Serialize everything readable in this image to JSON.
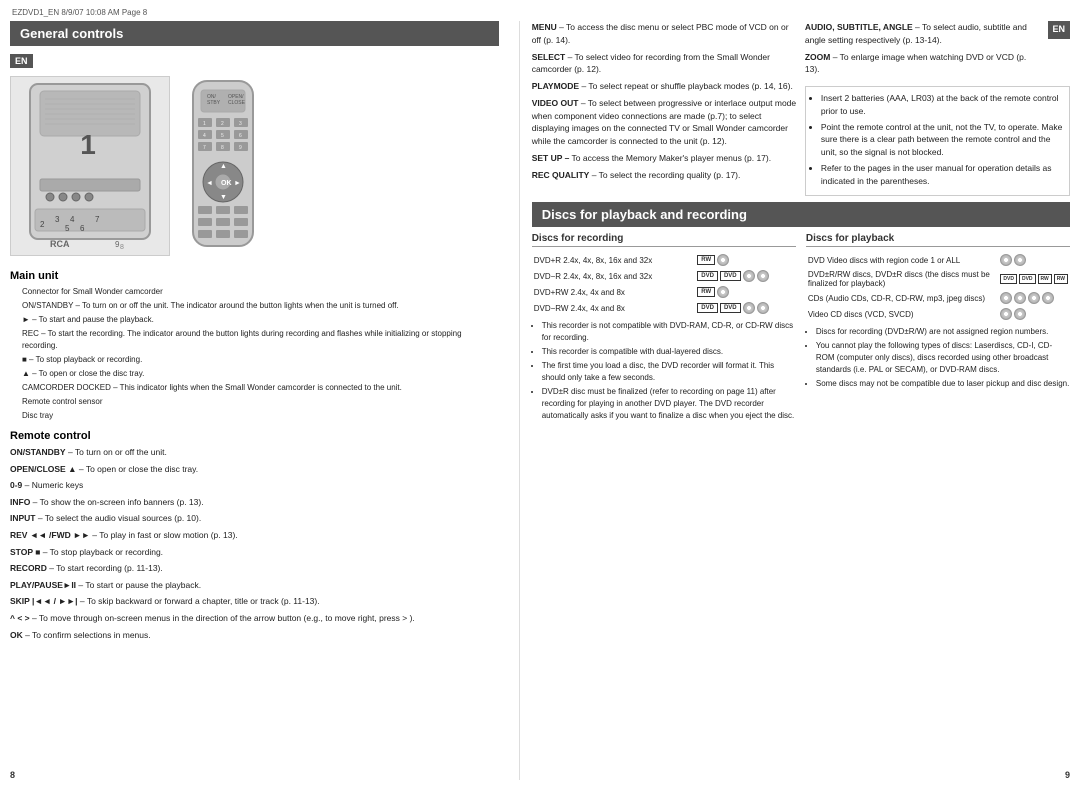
{
  "meta": {
    "file_info": "EZDVD1_EN  8/9/07  10:08 AM  Page 8"
  },
  "left_page": {
    "section_title": "General controls",
    "en_label": "EN",
    "device_label": "1",
    "bottom_labels": {
      "label2": "2",
      "label3": "3",
      "label4": "4",
      "label5": "5",
      "label6": "6",
      "label7": "7",
      "label8": "8",
      "label9": "9"
    },
    "main_unit_title": "Main unit",
    "main_unit_items": [
      "Connector for Small Wonder camcorder",
      "ON/STANDBY – To turn on or off the unit. The indicator around the button lights when the unit is turned off.",
      "► – To start and pause the playback.",
      "REC – To start the recording. The indicator around the button lights during recording and flashes while initializing or stopping recording.",
      "■ – To stop playback or recording.",
      "▲ – To open or close the disc tray.",
      "CAMCORDER DOCKED – This indicator lights when the Small Wonder camcorder is connected to the unit.",
      "Remote control sensor",
      "Disc tray"
    ],
    "remote_title": "Remote control",
    "remote_items": [
      {
        "term": "ON/STANDBY",
        "desc": " – To turn on or off the unit."
      },
      {
        "term": "OPEN/CLOSE ▲",
        "desc": " – To open or close the disc tray."
      },
      {
        "term": "0-9",
        "desc": "  –  Numeric keys"
      },
      {
        "term": "INFO",
        "desc": " – To show the on-screen info banners (p. 13)."
      },
      {
        "term": "INPUT",
        "desc": " – To select the audio visual sources (p. 10)."
      },
      {
        "term": "REV ◄◄ /FWD ►►",
        "desc": "  –  To play in fast or slow motion (p. 13)."
      },
      {
        "term": "STOP ■",
        "desc": " – To stop playback or recording."
      },
      {
        "term": "RECORD",
        "desc": " – To start recording (p. 11-13)."
      },
      {
        "term": "PLAY/PAUSE►II",
        "desc": " – To start or pause the playback."
      },
      {
        "term": "SKIP |◄◄ / ►►|",
        "desc": " – To skip backward or forward a chapter, title or track (p. 11-13)."
      },
      {
        "term": "^ ˂ ˃",
        "desc": " – To move through on-screen menus in the direction of the arrow button (e.g., to move right, press ˃ )."
      },
      {
        "term": "OK",
        "desc": " – To confirm selections in menus."
      }
    ],
    "page_number": "8"
  },
  "right_page": {
    "en_label": "EN",
    "top_left_items": [
      {
        "term": "MENU",
        "desc": " – To access the disc menu or select PBC mode of VCD on or off (p. 14)."
      },
      {
        "term": "SELECT",
        "desc": " – To select video for recording from the Small Wonder camcorder (p. 12)."
      },
      {
        "term": "PLAYMODE",
        "desc": " – To select repeat or shuffle playback modes (p. 14, 16)."
      },
      {
        "term": "VIDEO OUT",
        "desc": " – To select between progressive or interlace output mode when component video connections are made (p.7); to select displaying images on the connected TV or Small Wonder camcorder while the camcorder is connected to the unit (p. 12)."
      },
      {
        "term": "SET UP –",
        "desc": " To access the Memory Maker's player menus (p. 17)."
      },
      {
        "term": "REC QUALITY",
        "desc": " – To select the recording quality (p. 17)."
      }
    ],
    "top_right_items": [
      {
        "term": "AUDIO, SUBTITLE, ANGLE",
        "desc": " – To select audio, subtitle and angle setting respectively (p. 13-14)."
      },
      {
        "term": "ZOOM",
        "desc": " – To enlarge image when watching DVD or VCD (p. 13)."
      }
    ],
    "battery_notes": [
      "Insert 2 batteries (AAA, LR03) at the back of the remote control prior to use.",
      "Point the remote control at the unit, not the TV, to operate. Make sure there is a clear path between the remote control and the unit, so the signal is not blocked.",
      "Refer to the pages in the user manual for operation details as indicated in the parentheses."
    ],
    "discs_section_title": "Discs for playback and recording",
    "discs_recording_title": "Discs for recording",
    "discs_playback_title": "Discs for playback",
    "recording_discs": [
      {
        "name": "DVD+R 2.4x, 4x, 8x, 16x and 32x",
        "badge": "RW"
      },
      {
        "name": "DVD−R 2.4x, 4x, 8x, 16x and 32x",
        "badge": "DVD"
      },
      {
        "name": "DVD+RW 2.4x, 4x and 8x",
        "badge": "RW"
      },
      {
        "name": "DVD−RW 2.4x, 4x and 8x",
        "badge": "DVD"
      }
    ],
    "recording_notes": [
      "This recorder is not compatible with DVD-RAM, CD-R, or CD-RW discs for recording.",
      "This recorder is compatible with dual-layered discs.",
      "The first time you load a disc, the DVD recorder will format it. This should only take a few seconds.",
      "DVD±R disc must be finalized (refer to recording on page 11) after recording for playing in another DVD player. The DVD recorder automatically asks if you want to finalize a disc when you eject the disc."
    ],
    "playback_discs": [
      {
        "name": "DVD Video discs with region code 1 or ALL",
        "badge": "DVD"
      },
      {
        "name": "DVD±R/RW discs, DVD±R discs (the discs must be finalized for playback)",
        "badge": "DVDRW"
      },
      {
        "name": "CDs (Audio CDs, CD-R, CD-RW, mp3, jpeg discs)",
        "badge": "CD"
      },
      {
        "name": "Video CD discs (VCD, SVCD)",
        "badge": "VCD"
      }
    ],
    "playback_notes": [
      "Discs for recording (DVD±R/W) are not assigned region numbers.",
      "You cannot play the following types of discs: Laserdiscs, CD-I, CD-ROM (computer only discs), discs recorded using other broadcast standards (i.e. PAL or SECAM), or DVD-RAM discs.",
      "Some discs may not be compatible due to laser pickup and disc design."
    ],
    "page_number": "9"
  }
}
